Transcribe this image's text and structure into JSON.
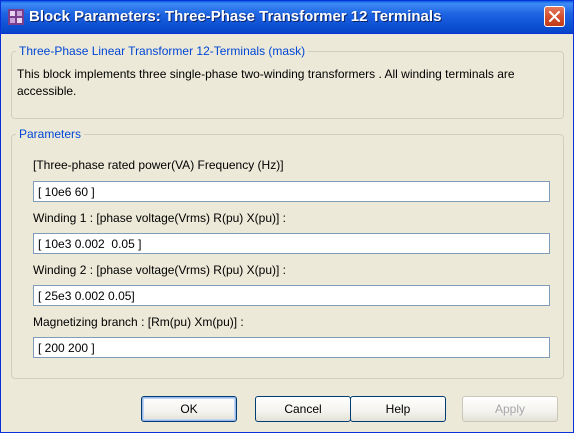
{
  "window": {
    "title": "Block Parameters: Three-Phase Transformer 12 Terminals"
  },
  "mask": {
    "legend": "Three-Phase Linear Transformer 12-Terminals (mask)",
    "description": "This block implements three single-phase two-winding transformers . All winding terminals are accessible."
  },
  "parameters": {
    "legend": "Parameters",
    "rated_power": {
      "label": "[Three-phase rated power(VA)  Frequency (Hz)]",
      "value": "[ 10e6 60 ]"
    },
    "winding1": {
      "label": "Winding 1 : [phase voltage(Vrms)  R(pu)  X(pu)] :",
      "value": "[ 10e3 0.002  0.05 ]"
    },
    "winding2": {
      "label": "Winding 2 : [phase voltage(Vrms)  R(pu)  X(pu)] :",
      "value": "[ 25e3 0.002 0.05]"
    },
    "magnetizing": {
      "label": "Magnetizing branch : [Rm(pu)  Xm(pu)] :",
      "value": "[ 200 200 ]"
    }
  },
  "buttons": {
    "ok": "OK",
    "cancel": "Cancel",
    "help": "Help",
    "apply": "Apply"
  }
}
